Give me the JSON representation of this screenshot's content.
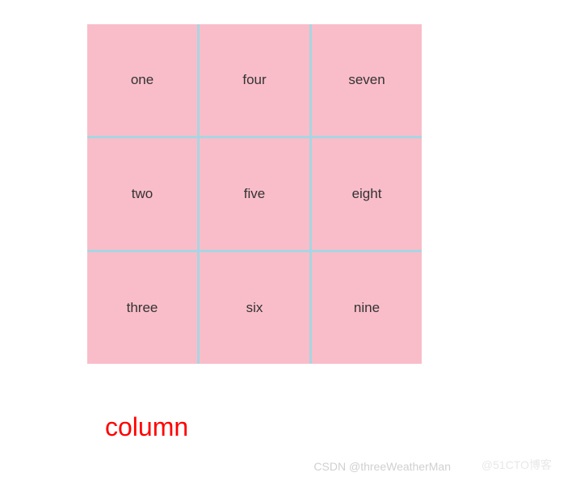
{
  "grid": {
    "items": [
      "one",
      "two",
      "three",
      "four",
      "five",
      "six",
      "seven",
      "eight",
      "nine"
    ]
  },
  "caption": "column",
  "watermarks": {
    "csdn": "CSDN @threeWeatherMan",
    "other": "@51CTO博客"
  }
}
